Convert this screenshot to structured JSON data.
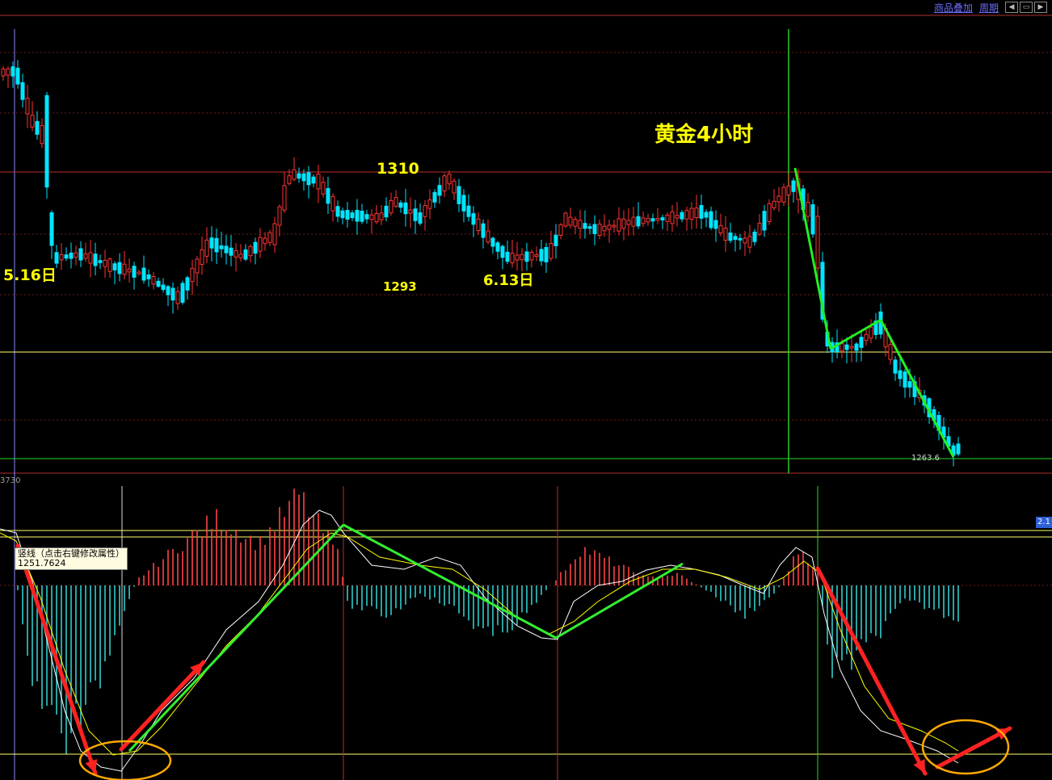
{
  "toolbar": {
    "overlay_label": "商品叠加",
    "period_label": "周期"
  },
  "chart_data": [
    {
      "type": "candlestick",
      "title": "黄金4小时",
      "annotations": [
        "5.16日",
        "1310",
        "1293",
        "6.13日"
      ],
      "last_low_label": "1263.6",
      "grid": true,
      "colors": {
        "up": "#ff3333",
        "down": "#00e5ff",
        "trend_line": "#22ee22",
        "horizontal": "#ffff66",
        "vertical": "#22cc22"
      }
    },
    {
      "type": "line",
      "indicator": "MACD",
      "top_label": "3730",
      "right_tag": "2.1",
      "tooltip_line1": "竖线（点击右键修改属性）",
      "tooltip_line2": "1251.7624",
      "colors": {
        "positive_bar": "#ff4444",
        "negative_bar": "#33cccc",
        "dif": "#ffffff",
        "dea": "#ffff00",
        "arrow": "#ff2222",
        "circle": "#ffaa00"
      }
    }
  ]
}
